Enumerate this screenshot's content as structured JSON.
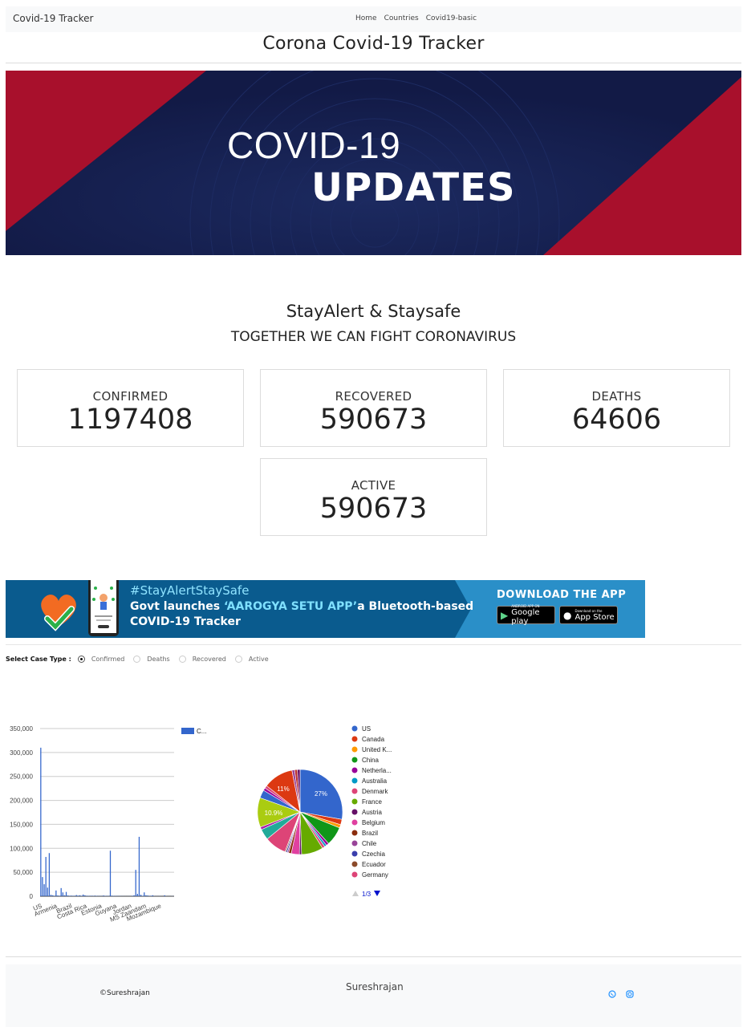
{
  "navbar": {
    "brand": "Covid-19 Tracker",
    "links": [
      "Home",
      "Countries",
      "Covid19-basic"
    ]
  },
  "page_title": "Corona Covid-19 Tracker",
  "banner": {
    "line1": "COVID-19",
    "line2": "UPDATES",
    "colors": {
      "navy": "#141d4a",
      "red": "#a8102c"
    }
  },
  "stay": {
    "title": "StayAlert & Staysafe",
    "subtitle": "TOGETHER WE CAN FIGHT CORONAVIRUS"
  },
  "stats": {
    "confirmed": {
      "label": "CONFIRMED",
      "value": "1197408"
    },
    "recovered": {
      "label": "RECOVERED",
      "value": "590673"
    },
    "deaths": {
      "label": "DEATHS",
      "value": "64606"
    },
    "active": {
      "label": "ACTIVE",
      "value": "590673"
    }
  },
  "app_banner": {
    "tag": "#StayAlertStaySafe",
    "line1_pre": "Govt launches ",
    "line1_hl": "‘AAROGYA SETU APP’",
    "line1_post": "a Bluetooth-based",
    "line2": "COVID-19 Tracker",
    "download": "DOWNLOAD THE APP",
    "google_small": "ANDROID APP ON",
    "google": "Google play",
    "apple_small": "Download on the",
    "apple": "App Store"
  },
  "case_type": {
    "label": "Select Case Type :",
    "options": [
      "Confirmed",
      "Deaths",
      "Recovered",
      "Active"
    ],
    "selected": "Confirmed"
  },
  "chart_data": [
    {
      "type": "bar",
      "legend": [
        "C..."
      ],
      "ylim": [
        0,
        350000
      ],
      "y_ticks": [
        "0",
        "50,000",
        "100,000",
        "150,000",
        "200,000",
        "250,000",
        "300,000",
        "350,000"
      ],
      "x_tick_labels": [
        "US",
        "Armenia",
        "Brazil",
        "Costa Rica",
        "Estonia",
        "Guyana",
        "Jordan",
        "MS Zaandam",
        "Mozambique"
      ],
      "values": [
        310000,
        40000,
        25000,
        82000,
        18000,
        90000,
        3000,
        2000,
        1000,
        12000,
        1500,
        1000,
        17000,
        8000,
        2000,
        9000,
        1500,
        1000,
        1200,
        900,
        1000,
        2500,
        1200,
        2000,
        1000,
        3500,
        2000,
        1000,
        800,
        600,
        1000,
        700,
        1200,
        800,
        500,
        600,
        400,
        1500,
        800,
        700,
        600,
        95000,
        1000,
        800,
        700,
        600,
        500,
        400,
        300,
        300,
        200,
        200,
        300,
        200,
        1000,
        2000,
        55000,
        5000,
        124000,
        3000,
        900,
        8000,
        2000,
        1500,
        500,
        1000,
        2000,
        400,
        300,
        200,
        300,
        200,
        100,
        2000,
        300,
        200,
        100,
        200,
        300
      ],
      "color": "#3366cc"
    },
    {
      "type": "pie",
      "labels": [
        "US",
        "Canada",
        "United K...",
        "China",
        "Netherla...",
        "Australia",
        "Denmark",
        "France",
        "Austria",
        "Belgium",
        "Brazil",
        "Chile",
        "Czechia",
        "Ecuador",
        "Germany"
      ],
      "values": [
        27,
        2,
        1.2,
        7,
        1,
        0.8,
        1,
        8,
        0.8,
        3,
        1,
        0.5,
        0.5,
        0.4,
        8
      ],
      "other_slices": [
        {
          "value": 4,
          "color": "#22aa99"
        },
        {
          "value": 1,
          "color": "#aa22aa"
        },
        {
          "value": 10.9,
          "color": "#aacc11"
        },
        {
          "value": 3,
          "color": "#3366cc"
        },
        {
          "value": 1,
          "color": "#990099"
        },
        {
          "value": 1,
          "color": "#dd4477"
        },
        {
          "value": 11,
          "color": "#dc3912"
        },
        {
          "value": 1,
          "color": "#994499"
        },
        {
          "value": 1,
          "color": "#b82e2e"
        },
        {
          "value": 1,
          "color": "#651067"
        }
      ],
      "slice_labels": [
        "27%",
        "11%",
        "10.9%"
      ],
      "colors": [
        "#3366cc",
        "#dc3912",
        "#ff9900",
        "#109618",
        "#990099",
        "#0099c6",
        "#dd4477",
        "#66aa00",
        "#651067",
        "#e040a0",
        "#8b2d0d",
        "#994499",
        "#3b3eac",
        "#8b4a2a",
        "#dd4477"
      ],
      "pager": "1/3"
    }
  ],
  "footer": {
    "copy": "©Sureshrajan",
    "name": "Sureshrajan",
    "icons": [
      "whatsapp-icon",
      "instagram-icon"
    ]
  }
}
